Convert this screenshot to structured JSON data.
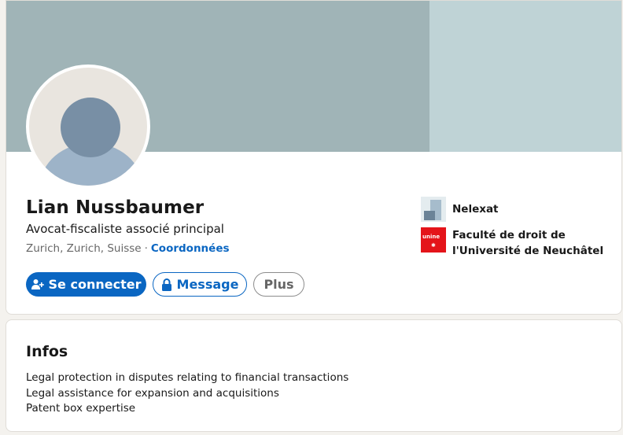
{
  "profile": {
    "name": "Lian Nussbaumer",
    "headline": "Avocat-fiscaliste associé principal",
    "location": "Zurich, Zurich, Suisse",
    "separator": "·",
    "contact_label": "Coordonnées",
    "avatar_icon": "default-person-avatar",
    "accent_color": "#0a66c2"
  },
  "actions": {
    "connect_label": "Se connecter",
    "connect_icon": "add-person-icon",
    "message_label": "Message",
    "message_icon": "lock-icon",
    "more_label": "Plus"
  },
  "organizations": [
    {
      "name": "Nelexat",
      "logo": "nelexat-logo"
    },
    {
      "name": "Faculté de droit de l'Université de Neuchâtel",
      "logo": "unine-logo",
      "logo_text": "unine"
    }
  ],
  "about": {
    "title": "Infos",
    "lines": [
      "Legal protection in disputes relating to financial transactions",
      "Legal assistance for expansion and acquisitions",
      "Patent box expertise"
    ]
  }
}
